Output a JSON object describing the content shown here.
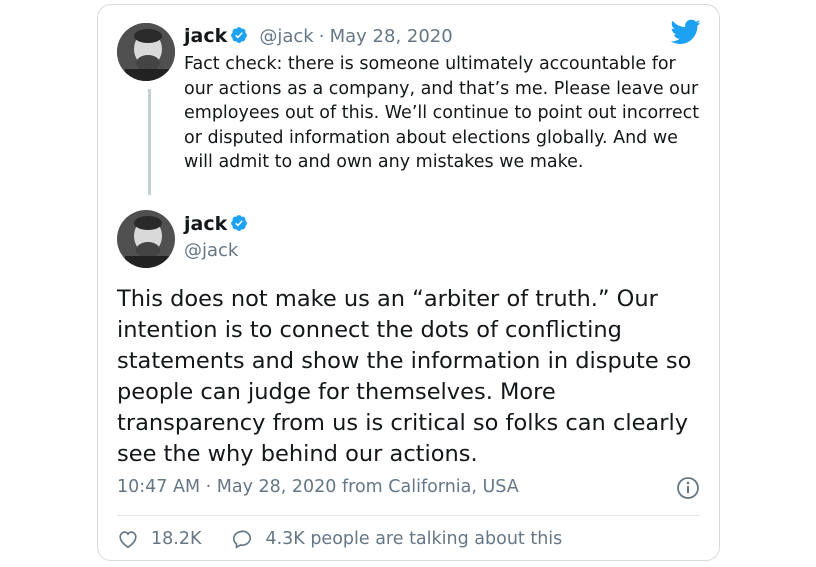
{
  "colors": {
    "accent": "#1da1f2",
    "text": "#14171a",
    "muted": "#657786",
    "border": "#d6dbe0"
  },
  "quoted": {
    "name": "jack",
    "handle": "@jack",
    "separator": "·",
    "date": "May 28, 2020",
    "text": "Fact check: there is someone ultimately accountable for our actions as a company, and that’s me. Please leave our employees out of this. We’ll continue to point out incorrect or disputed information about elections globally. And we will admit to and own any mistakes we make."
  },
  "tweet": {
    "name": "jack",
    "handle": "@jack",
    "text": "This does not make us an “arbiter of truth.” Our intention is to connect the dots of conflicting statements and show the information in dispute so people can judge for themselves. More transparency from us is critical so folks can clearly see the why behind our actions.",
    "timestamp": "10:47 AM · May 28, 2020 from California, USA"
  },
  "actions": {
    "likes": "18.2K",
    "talking": "4.3K people are talking about this"
  },
  "icons": {
    "logo": "twitter-bird-icon",
    "verified": "verified-badge-icon",
    "info": "info-icon",
    "like": "heart-icon",
    "reply": "speech-bubble-icon"
  }
}
